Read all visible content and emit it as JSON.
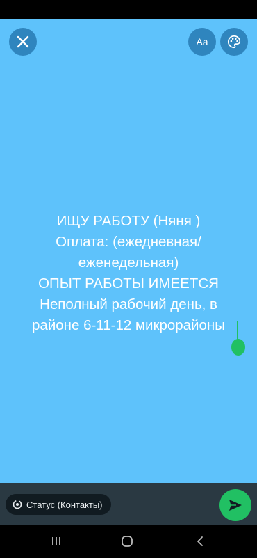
{
  "editor": {
    "background_color": "#5EC2FB",
    "font_button_label": "Aa",
    "status_lines": [
      "ИЩУ РАБОТУ (Няня )",
      "Оплата: (ежедневная/",
      "еженедельная)",
      "ОПЫТ РАБОТЫ ИМЕЕТСЯ",
      "Неполный рабочий день, в",
      "районе 6-11-12 микрорайоны"
    ],
    "icons": {
      "close": "close-icon",
      "palette": "palette-icon"
    }
  },
  "bottom_bar": {
    "audience_label": "Статус (Контакты)",
    "audience_icon": "status-ring-icon",
    "send_icon": "send-icon",
    "accent_color": "#21C063"
  },
  "nav_bar": {
    "recent_icon": "recent-apps-icon",
    "home_icon": "home-icon",
    "back_icon": "back-icon"
  }
}
